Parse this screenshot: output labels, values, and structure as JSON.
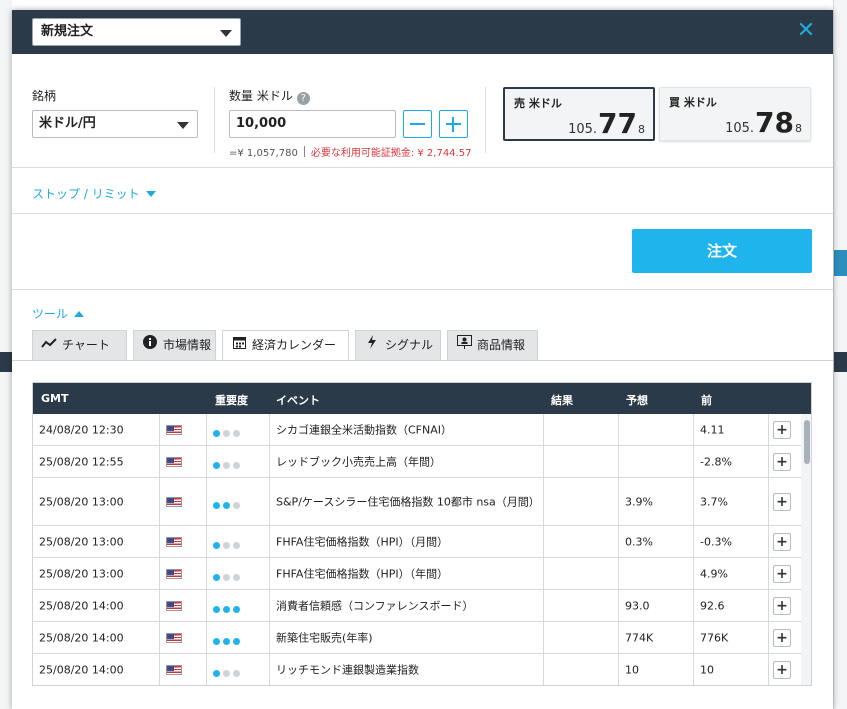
{
  "header": {
    "order_type": "新規注文",
    "close": "✕"
  },
  "order": {
    "pair_label": "銘柄",
    "pair_value": "米ドル/円",
    "qty_label": "数量 米ドル",
    "help": "?",
    "qty_value": "10,000",
    "minus": "−",
    "plus": "+",
    "equiv": "=¥ 1,057,780",
    "margin_note": "必要な利用可能証拠金: ¥ 2,744.57",
    "sell": {
      "label": "売 米ドル",
      "prefix": "105.",
      "pips": "77",
      "fraction": "8"
    },
    "buy": {
      "label": "買 米ドル",
      "prefix": "105.",
      "pips": "78",
      "fraction": "8"
    }
  },
  "stop_limit": "ストップ / リミット",
  "order_button": "注文",
  "tools": {
    "label": "ツール",
    "tabs": [
      {
        "icon": "chart-line-icon",
        "label": "チャート"
      },
      {
        "icon": "info-icon",
        "label": "市場情報"
      },
      {
        "icon": "calendar-icon",
        "label": "経済カレンダー"
      },
      {
        "icon": "signal-icon",
        "label": "シグナル"
      },
      {
        "icon": "presentation-icon",
        "label": "商品情報"
      }
    ],
    "active_tab": 2
  },
  "calendar": {
    "columns": {
      "gmt": "GMT",
      "importance": "重要度",
      "event": "イベント",
      "result": "結果",
      "forecast": "予想",
      "previous": "前"
    },
    "rows": [
      {
        "time": "24/08/20 12:30",
        "importance": 1,
        "event": "シカゴ連銀全米活動指数（CFNAI）",
        "result": "",
        "forecast": "",
        "previous": "4.11"
      },
      {
        "time": "25/08/20 12:55",
        "importance": 1,
        "event": "レッドブック小売売上高（年間）",
        "result": "",
        "forecast": "",
        "previous": "-2.8%"
      },
      {
        "time": "25/08/20 13:00",
        "importance": 2,
        "event": "S&P/ケースシラー住宅価格指数 10都市 nsa（月間）",
        "result": "",
        "forecast": "3.9%",
        "previous": "3.7%"
      },
      {
        "time": "25/08/20 13:00",
        "importance": 1,
        "event": "FHFA住宅価格指数（HPI）（月間）",
        "result": "",
        "forecast": "0.3%",
        "previous": "-0.3%"
      },
      {
        "time": "25/08/20 13:00",
        "importance": 1,
        "event": "FHFA住宅価格指数（HPI）（年間）",
        "result": "",
        "forecast": "",
        "previous": "4.9%"
      },
      {
        "time": "25/08/20 14:00",
        "importance": 3,
        "event": "消費者信頼感（コンファレンスボード）",
        "result": "",
        "forecast": "93.0",
        "previous": "92.6"
      },
      {
        "time": "25/08/20 14:00",
        "importance": 3,
        "event": "新築住宅販売(年率)",
        "result": "",
        "forecast": "774K",
        "previous": "776K"
      },
      {
        "time": "25/08/20 14:00",
        "importance": 1,
        "event": "リッチモンド連銀製造業指数",
        "result": "",
        "forecast": "10",
        "previous": "10"
      }
    ],
    "add": "+"
  },
  "colors": {
    "header": "#2b3a48",
    "accent": "#1fa9e1",
    "order_button": "#1fb5ec",
    "warning": "#d9363e"
  }
}
